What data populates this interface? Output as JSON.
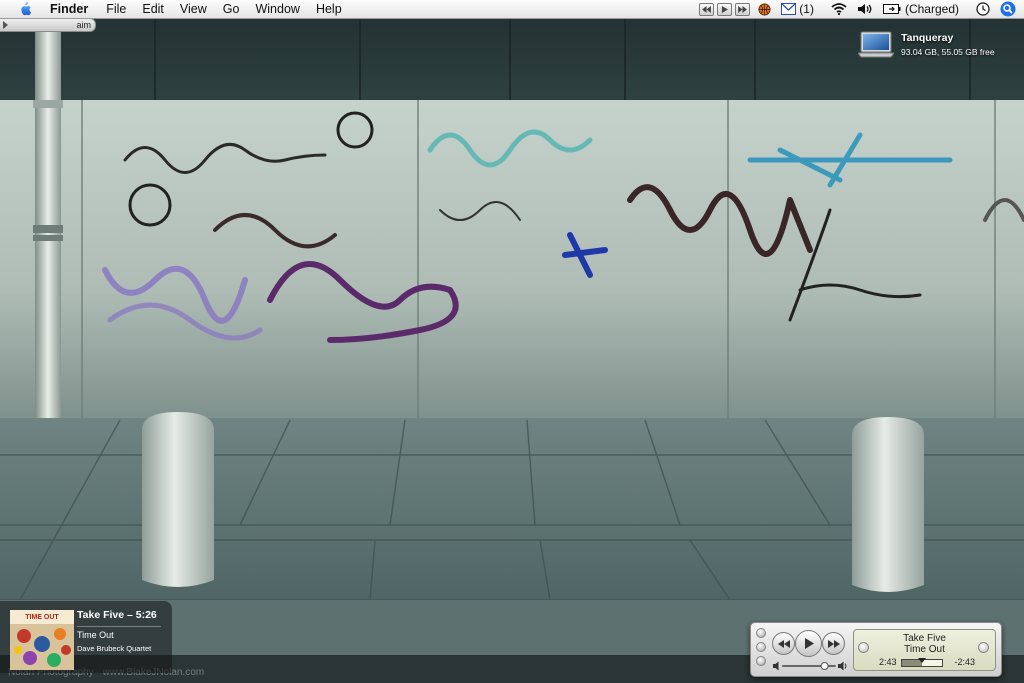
{
  "menubar": {
    "app_name": "Finder",
    "menus": [
      "File",
      "Edit",
      "View",
      "Go",
      "Window",
      "Help"
    ],
    "mail_count": "(1)",
    "battery_status": "(Charged)",
    "icons": [
      "apple-icon",
      "media-previous-icon",
      "media-play-icon",
      "media-next-icon",
      "basketball-icon",
      "mail-icon",
      "wifi-icon",
      "volume-icon",
      "battery-icon",
      "clock-icon",
      "spotlight-icon"
    ]
  },
  "aim_badge": {
    "label": "aim"
  },
  "desktop": {
    "drive": {
      "name": "Tanqueray",
      "info": "93.04 GB, 55.05 GB free",
      "icon": "laptop-drive-icon"
    },
    "watermark": "Nolan Photography · www.BlakeJNolan.com"
  },
  "now_playing": {
    "track": "Take Five – 5:26",
    "album": "Time Out",
    "artist": "Dave Brubeck Quartet",
    "art_text": "TIME OUT"
  },
  "mini_player": {
    "title": "Take Five",
    "album": "Time Out",
    "elapsed": "2:43",
    "remaining": "-2:43",
    "progress": 0.5,
    "volume": 0.8
  }
}
